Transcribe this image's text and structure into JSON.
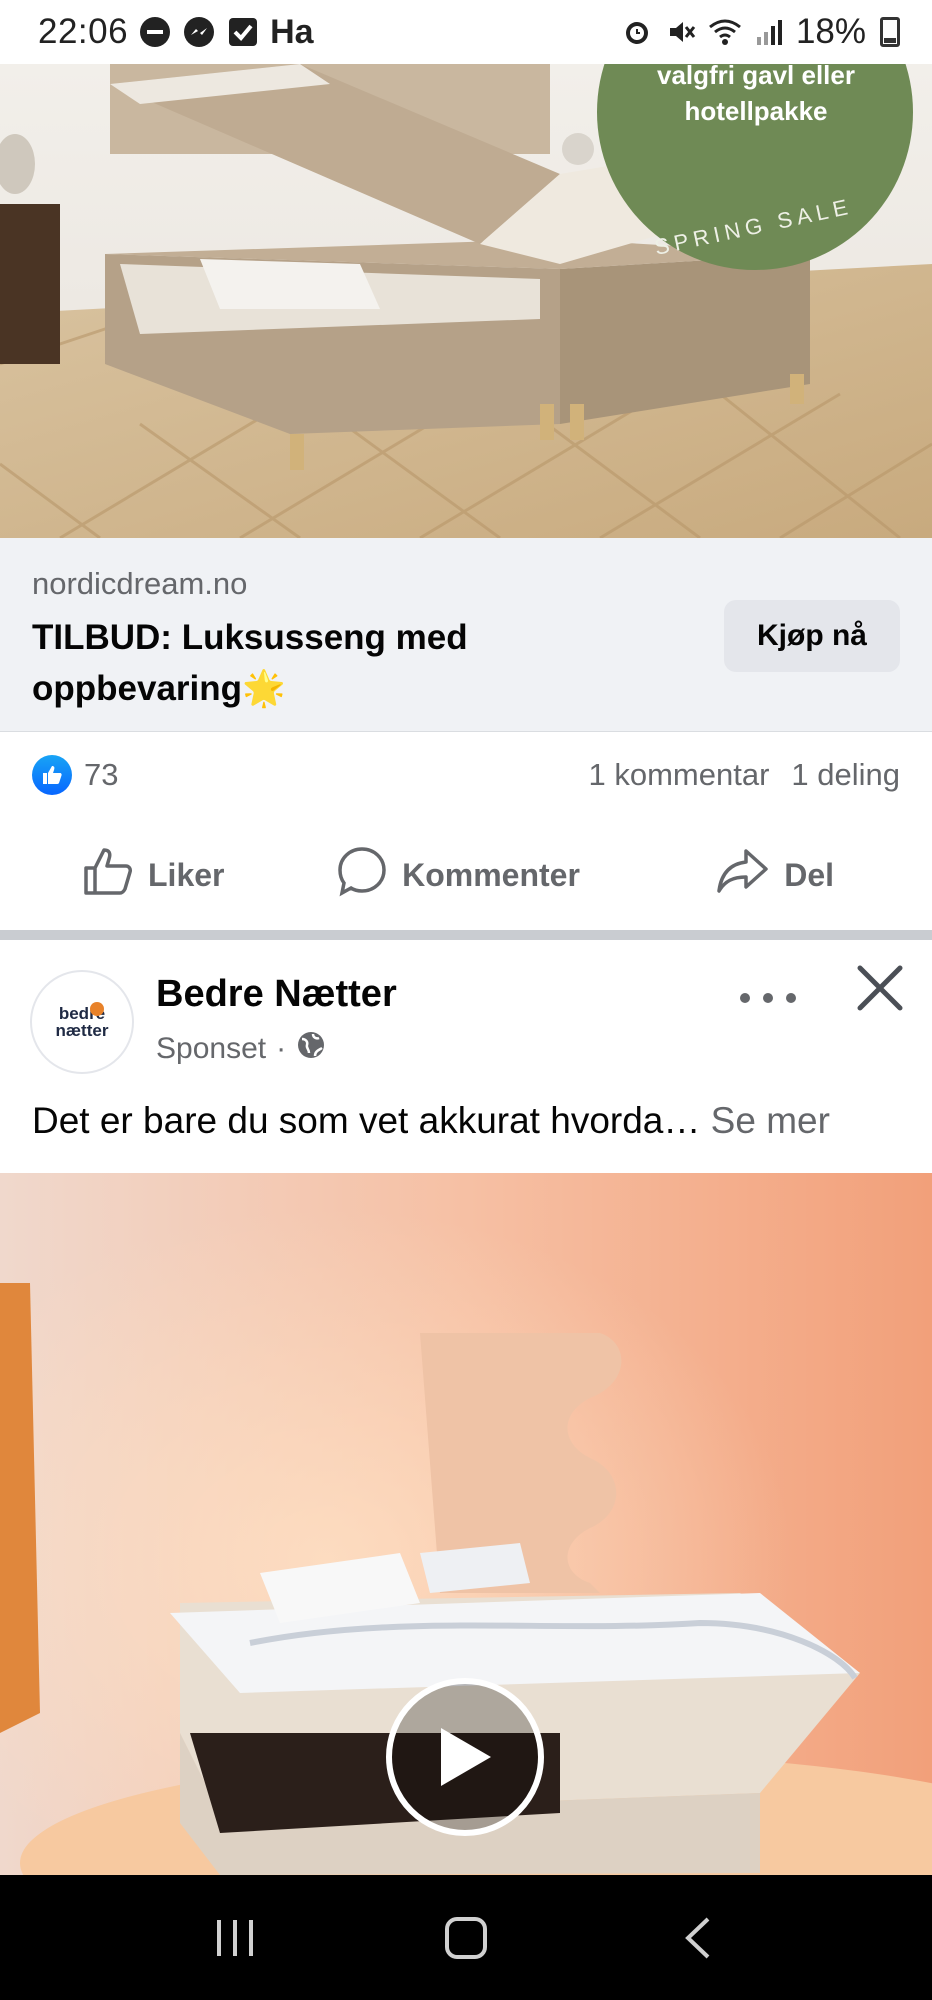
{
  "status_bar": {
    "time": "22:06",
    "left_text": "Ha",
    "battery": "18%",
    "icons": [
      "dnd-icon",
      "messenger-icon",
      "checkbox-icon",
      "alarm-icon",
      "mute-icon",
      "wifi-icon",
      "signal-icon",
      "battery-icon"
    ]
  },
  "ad1": {
    "image_badge": {
      "line1": "valgfri gavl eller",
      "line2": "hotellpakke",
      "ring_text": "SPRING SALE"
    },
    "link_card": {
      "domain": "nordicdream.no",
      "title": "TILBUD: Luksusseng med oppbevaring🌟",
      "cta_label": "Kjøp nå"
    },
    "reactions": {
      "count": "73",
      "comments": "1 kommentar",
      "shares": "1 deling"
    },
    "actions": {
      "like": "Liker",
      "comment": "Kommenter",
      "share": "Del"
    }
  },
  "ad2": {
    "avatar": {
      "line1": "bedre",
      "line2": "nætter"
    },
    "page_name": "Bedre Nætter",
    "sponsored": "Sponset",
    "separator": "·",
    "text": "Det er bare du som vet akkurat hvorda…",
    "see_more": "Se mer"
  },
  "colors": {
    "link_card_bg": "#f0f2f5",
    "button_bg": "#e4e6eb",
    "secondary_text": "#65676b",
    "like_blue": "#0866ff",
    "badge_green": "#6f8a55"
  }
}
